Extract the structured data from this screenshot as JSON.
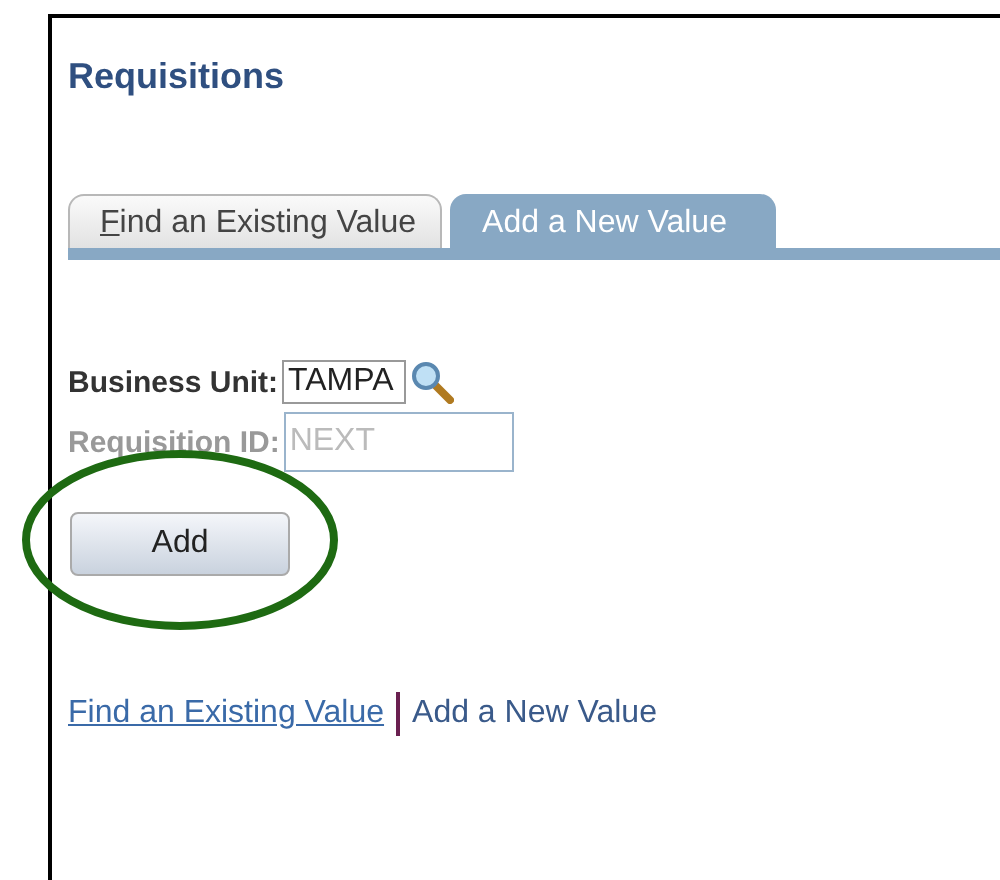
{
  "page": {
    "title": "Requisitions"
  },
  "tabs": [
    {
      "label": "Find an Existing Value",
      "selected": false
    },
    {
      "label": "Add a New Value",
      "selected": true
    }
  ],
  "fields": [
    {
      "label": "Business Unit:",
      "value": "TAMPA",
      "disabled": false,
      "lookup": true
    },
    {
      "label": "Requisition ID:",
      "value": "NEXT",
      "disabled": true,
      "lookup": false
    }
  ],
  "add_button": {
    "label": "Add",
    "highlighted": true
  },
  "links": [
    {
      "label": "Find an Existing Value",
      "selected": false
    },
    {
      "label": "Add a New Value",
      "selected": true
    }
  ]
}
